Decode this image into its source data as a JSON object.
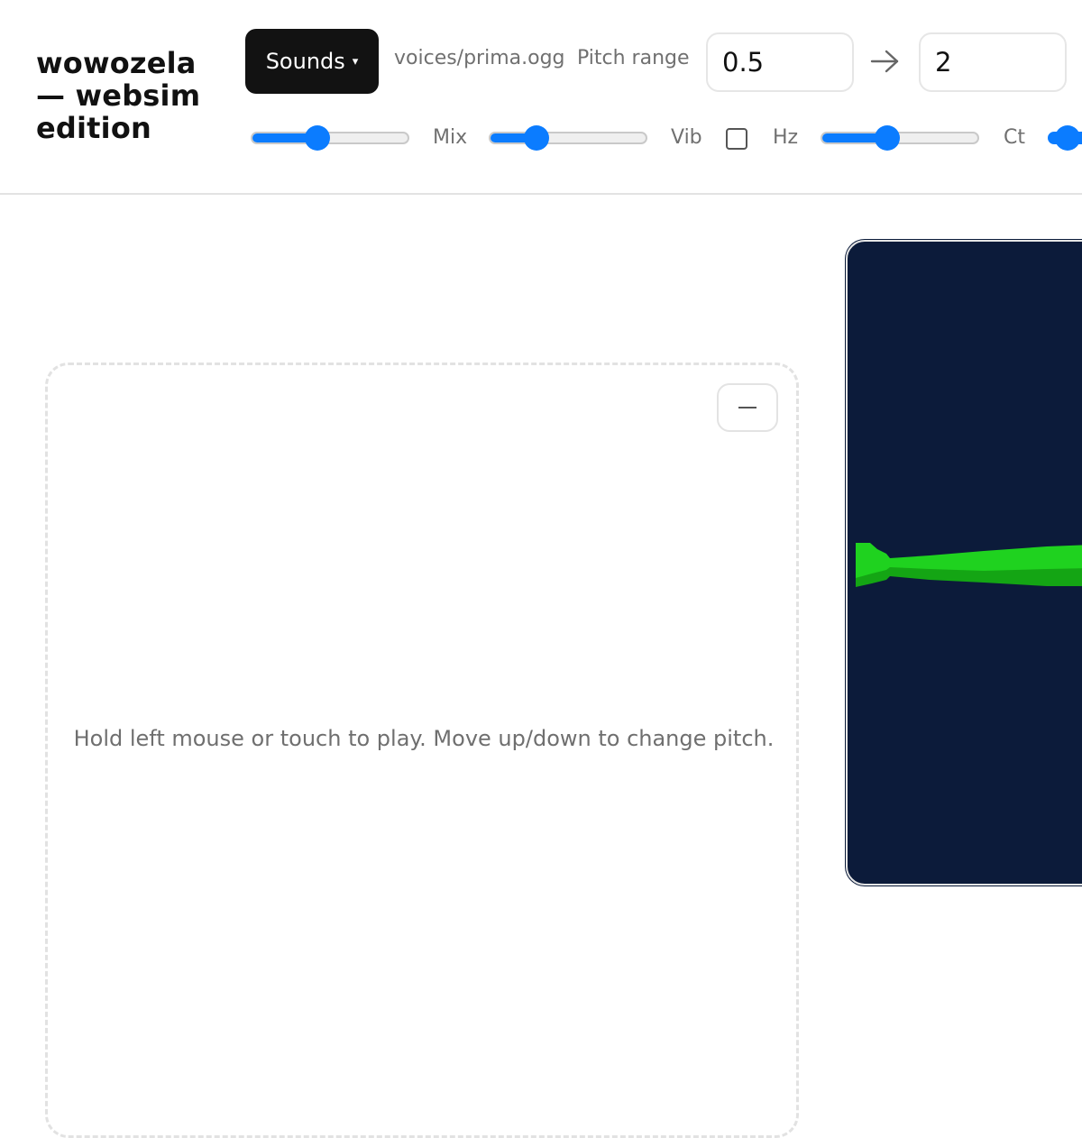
{
  "header": {
    "title": "wowozela — websim edition",
    "sounds_label": "Sounds",
    "sounds_caret": "▾",
    "voice_file": "voices/prima.ogg",
    "pitch_range_label": "Pitch range",
    "pitch_min": "0.5",
    "pitch_max": "2"
  },
  "controls": {
    "volume_level": 0.42,
    "mix_label": "Mix",
    "mix_level": 0.3,
    "vib_label": "Vib",
    "vib_checked": false,
    "hz_label": "Hz",
    "hz_level": 0.42,
    "ct_label": "Ct"
  },
  "pad": {
    "hint": "Hold left mouse or touch to play. Move up/down to change pitch.",
    "collapse_icon": "minus-icon"
  },
  "visualizer": {
    "background": "#0c1b3a",
    "shape_color_light": "#1fd21f",
    "shape_color_dark": "#14a514",
    "icon": "trumpet-shape"
  },
  "colors": {
    "accent": "#0b7cff",
    "button_dark": "#121212"
  }
}
